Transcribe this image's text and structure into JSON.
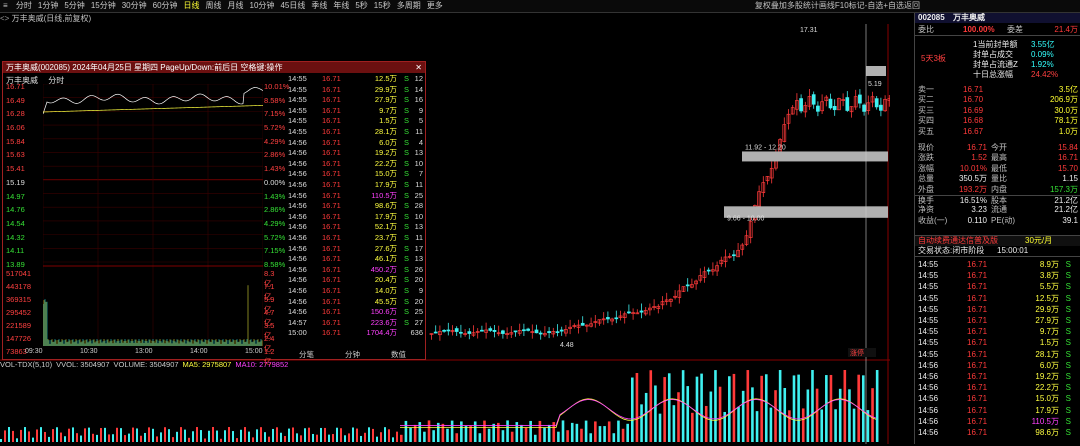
{
  "toolbar": {
    "periods": [
      "分时",
      "1分钟",
      "5分钟",
      "15分钟",
      "30分钟",
      "60分钟",
      "日线",
      "周线",
      "月线",
      "10分钟",
      "45日线",
      "季线",
      "年线",
      "5秒",
      "15秒",
      "多周期",
      "更多"
    ],
    "active_period": "日线",
    "right_buttons": [
      "复权",
      "叠加",
      "多股",
      "统计",
      "画线",
      "F10",
      "标记",
      "-自选",
      "+自选",
      "返回"
    ]
  },
  "header": {
    "stock_title": "万丰奥威(日线,前复权)"
  },
  "popup": {
    "title": "万丰奥威(002085) 2024年04月25日 星期四 PageUp/Down:前后日 空格键:操作",
    "sub_left": "万丰奥威",
    "sub_right": "分时",
    "left_prices": [
      "16.71",
      "16.49",
      "16.28",
      "16.06",
      "15.84",
      "15.63",
      "15.41",
      "15.19",
      "14.97",
      "14.76",
      "14.54",
      "14.32",
      "14.11",
      "13.89",
      "517041",
      "443178",
      "369315",
      "295452",
      "221589",
      "147726",
      "73863"
    ],
    "right_pcts": [
      "10.01%",
      "8.58%",
      "7.15%",
      "5.72%",
      "4.29%",
      "2.86%",
      "1.43%",
      "0.00%",
      "1.43%",
      "2.86%",
      "4.29%",
      "5.72%",
      "7.15%",
      "8.58%",
      "8.3亿",
      "7.1亿",
      "5.9亿",
      "4.7亿",
      "3.5亿",
      "2.4亿",
      "1.2亿"
    ],
    "time_axis": [
      "09:30",
      "10:30",
      "13:00",
      "14:00",
      "15:00"
    ],
    "trades": [
      [
        "14:55",
        "16.71",
        "12.5万",
        "S",
        "12"
      ],
      [
        "14:55",
        "16.71",
        "29.9万",
        "S",
        "14"
      ],
      [
        "14:55",
        "16.71",
        "27.9万",
        "S",
        "16"
      ],
      [
        "14:55",
        "16.71",
        "9.7万",
        "S",
        "9"
      ],
      [
        "14:55",
        "16.71",
        "1.5万",
        "S",
        "5"
      ],
      [
        "14:55",
        "16.71",
        "28.1万",
        "S",
        "11"
      ],
      [
        "14:56",
        "16.71",
        "6.0万",
        "S",
        "4"
      ],
      [
        "14:56",
        "16.71",
        "19.2万",
        "S",
        "13"
      ],
      [
        "14:56",
        "16.71",
        "22.2万",
        "S",
        "10"
      ],
      [
        "14:56",
        "16.71",
        "15.0万",
        "S",
        "7"
      ],
      [
        "14:56",
        "16.71",
        "17.9万",
        "S",
        "11"
      ],
      [
        "14:56",
        "16.71",
        "110.5万",
        "S",
        "25"
      ],
      [
        "14:56",
        "16.71",
        "98.6万",
        "S",
        "28"
      ],
      [
        "14:56",
        "16.71",
        "17.9万",
        "S",
        "10"
      ],
      [
        "14:56",
        "16.71",
        "52.1万",
        "S",
        "13"
      ],
      [
        "14:56",
        "16.71",
        "23.7万",
        "S",
        "11"
      ],
      [
        "14:56",
        "16.71",
        "27.6万",
        "S",
        "17"
      ],
      [
        "14:56",
        "16.71",
        "46.1万",
        "S",
        "13"
      ],
      [
        "14:56",
        "16.71",
        "450.2万",
        "S",
        "26"
      ],
      [
        "14:56",
        "16.71",
        "20.4万",
        "S",
        "20"
      ],
      [
        "14:56",
        "16.71",
        "14.0万",
        "S",
        "9"
      ],
      [
        "14:56",
        "16.71",
        "45.5万",
        "S",
        "20"
      ],
      [
        "14:56",
        "16.71",
        "150.6万",
        "S",
        "25"
      ],
      [
        "14:57",
        "16.71",
        "223.6万",
        "S",
        "27"
      ],
      [
        "15:00",
        "16.71",
        "1704.4万",
        "",
        "636"
      ]
    ],
    "tabs": [
      "分笔",
      "分钟",
      "数值"
    ]
  },
  "kline": {
    "annot_high": "17.31",
    "annot_low": "4.48",
    "gap1": "11.92 - 12.20",
    "gap2": "9.66 - 10.00",
    "last": "5.19",
    "right_axis": [
      "16.00",
      "15.00",
      "14.00",
      "13.00",
      "12.00",
      "11.00",
      "10.00",
      "9.00",
      "8.00",
      "7.00",
      "6.00",
      "5.00"
    ],
    "badge": "涨停"
  },
  "volume": {
    "header": [
      "VOL-TDX(5,10)",
      "VVOL: 3504907",
      "VOLUME: 3504907",
      "MA5: 2975807",
      "MA10: 2779852"
    ],
    "right_axis": [
      "40000",
      "30000",
      "20000",
      "10000",
      "X100"
    ]
  },
  "panel": {
    "code": "002085",
    "name": "万丰奥威",
    "weibi_label": "委比",
    "weibi_value": "100.00%",
    "weicha_label": "委差",
    "weicha_value": "21.4万",
    "streak": "5天3板",
    "seal_lines": [
      [
        "1当前封单额",
        "3.55亿"
      ],
      [
        "封单占成交",
        "0.09%"
      ],
      [
        "封单占流通Z",
        "1.92%"
      ],
      [
        "十日总涨幅",
        "24.42%"
      ]
    ],
    "orderbook": [
      [
        "卖一",
        "16.71",
        "3.5亿"
      ],
      [
        "买二",
        "16.70",
        "206.9万"
      ],
      [
        "买三",
        "16.69",
        "30.0万"
      ],
      [
        "买四",
        "16.68",
        "78.1万"
      ],
      [
        "买五",
        "16.67",
        "1.0万"
      ]
    ],
    "quote": [
      [
        "现价",
        "16.71",
        "今开",
        "15.84"
      ],
      [
        "涨跌",
        "1.52",
        "最高",
        "16.71"
      ],
      [
        "涨幅",
        "10.01%",
        "最低",
        "15.70"
      ],
      [
        "总量",
        "350.5万",
        "量比",
        "1.15"
      ],
      [
        "外盘",
        "193.2万",
        "内盘",
        "157.3万"
      ],
      [
        "换手",
        "16.51%",
        "股本",
        "21.2亿"
      ],
      [
        "净资",
        "3.23",
        "流通",
        "21.2亿"
      ],
      [
        "收益(一)",
        "0.110",
        "PE(动)",
        "39.1"
      ]
    ],
    "promo": "自动续费通达信普及版",
    "promo_price": "30元/月",
    "trade_status": "交易状态:闭市阶段",
    "trade_time": "15:00:01",
    "ticks": [
      [
        "14:55",
        "16.71",
        "8.9万",
        "S"
      ],
      [
        "14:55",
        "16.71",
        "3.8万",
        "S"
      ],
      [
        "14:55",
        "16.71",
        "5.5万",
        "S"
      ],
      [
        "14:55",
        "16.71",
        "12.5万",
        "S"
      ],
      [
        "14:55",
        "16.71",
        "29.9万",
        "S"
      ],
      [
        "14:55",
        "16.71",
        "27.9万",
        "S"
      ],
      [
        "14:55",
        "16.71",
        "9.7万",
        "S"
      ],
      [
        "14:55",
        "16.71",
        "1.5万",
        "S"
      ],
      [
        "14:55",
        "16.71",
        "28.1万",
        "S"
      ],
      [
        "14:56",
        "16.71",
        "6.0万",
        "S"
      ],
      [
        "14:56",
        "16.71",
        "19.2万",
        "S"
      ],
      [
        "14:56",
        "16.71",
        "22.2万",
        "S"
      ],
      [
        "14:56",
        "16.71",
        "15.0万",
        "S"
      ],
      [
        "14:56",
        "16.71",
        "17.9万",
        "S"
      ],
      [
        "14:56",
        "16.71",
        "110.5万",
        "S"
      ],
      [
        "14:56",
        "16.71",
        "98.6万",
        "S"
      ]
    ]
  },
  "colors": {
    "up": "#ff3a3a",
    "down": "#3ff0f0",
    "yellow": "#ffff30",
    "green": "#35e035"
  }
}
